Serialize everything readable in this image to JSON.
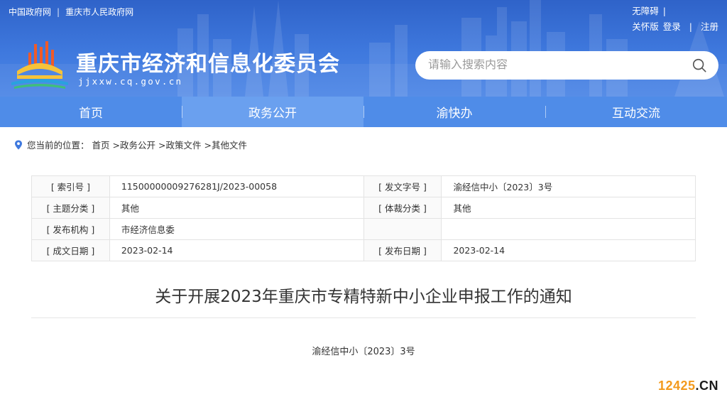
{
  "top_links": {
    "gov_cn": "中国政府网",
    "sep": "|",
    "cq_gov": "重庆市人民政府网"
  },
  "right_links": {
    "accessibility": "无障碍",
    "sep": "|",
    "care_mode": "关怀版",
    "login": "登录",
    "register": "注册"
  },
  "site": {
    "title": "重庆市经济和信息化委员会",
    "domain": "jjxxw.cq.gov.cn"
  },
  "search": {
    "placeholder": "请输入搜索内容"
  },
  "nav": {
    "items": [
      {
        "label": "首页"
      },
      {
        "label": "政务公开"
      },
      {
        "label": "渝快办"
      },
      {
        "label": "互动交流"
      }
    ],
    "active": "政务公开"
  },
  "breadcrumb": {
    "prefix": "您当前的位置：",
    "items": [
      "首页",
      ">政务公开",
      ">政策文件",
      ">其他文件"
    ]
  },
  "meta": {
    "index_no_label": "[ 索引号 ]",
    "index_no": "11500000009276281J/2023-00058",
    "doc_no_label": "[ 发文字号 ]",
    "doc_no": "渝经信中小〔2023〕3号",
    "topic_label": "[ 主题分类 ]",
    "topic": "其他",
    "genre_label": "[ 体裁分类 ]",
    "genre": "其他",
    "issuer_label": "[ 发布机构 ]",
    "issuer": "市经济信息委",
    "created_label": "[ 成文日期 ]",
    "created": "2023-02-14",
    "published_label": "[ 发布日期 ]",
    "published": "2023-02-14"
  },
  "article": {
    "title": "关于开展2023年重庆市专精特新中小企业申报工作的通知",
    "doc_number": "渝经信中小〔2023〕3号"
  },
  "watermark": {
    "num": "12425",
    "tld": ".CN"
  },
  "colors": {
    "banner": "#3f79de",
    "nav": "#4f8ce8",
    "nav_active": "#6aa0ef",
    "watermark_orange": "#f39a1d"
  }
}
